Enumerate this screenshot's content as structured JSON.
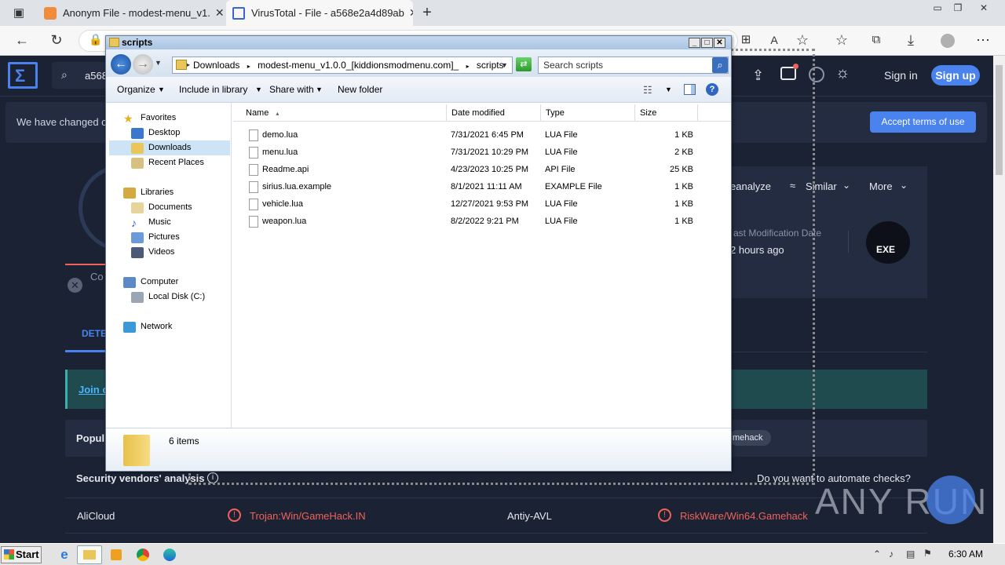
{
  "browser": {
    "tabs": [
      {
        "title": "Anonym File - modest-menu_v1.",
        "close": "✕"
      },
      {
        "title": "VirusTotal - File - a568e2a4d89ab",
        "close": "✕"
      }
    ],
    "new_tab": "+",
    "window_controls": [
      "▭",
      "❐",
      "✕"
    ]
  },
  "site": {
    "search_value": "a568",
    "sign_in": "Sign in",
    "sign_up": "Sign up",
    "banner_text": "We have changed o",
    "accept_button": "Accept terms of use",
    "actions": {
      "reanalyze": "eanalyze",
      "similar": "Similar",
      "more": "More"
    },
    "last_mod_label": "ast Modification Date",
    "last_mod_value": "2 hours ago",
    "file_type_badge": "EXE",
    "community_short": "Co",
    "tab_detection_short": "DETE",
    "join_link": "Join o",
    "popular_short": "Popul",
    "gamehack_tag": "mehack",
    "vendors_title": "Security vendors' analysis",
    "automate": "Do you want to automate checks?",
    "vendors": [
      {
        "name": "AliCloud",
        "result": "Trojan:Win/GameHack.IN"
      },
      {
        "name": "Antiy-AVL",
        "result": "RiskWare/Win64.Gamehack"
      }
    ],
    "accent": "#4a83ee",
    "alert_color": "#f0625b"
  },
  "explorer": {
    "title": "scripts",
    "breadcrumb": [
      "Downloads",
      "modest-menu_v1.0.0_[kiddionsmodmenu.com]_",
      "scripts"
    ],
    "search_placeholder": "Search scripts",
    "toolbar": {
      "organize": "Organize",
      "include": "Include in library",
      "share": "Share with",
      "new_folder": "New folder"
    },
    "nav": {
      "favorites": "Favorites",
      "desktop": "Desktop",
      "downloads": "Downloads",
      "recent": "Recent Places",
      "libraries": "Libraries",
      "documents": "Documents",
      "music": "Music",
      "pictures": "Pictures",
      "videos": "Videos",
      "computer": "Computer",
      "local_disk": "Local Disk (C:)",
      "network": "Network"
    },
    "columns": {
      "name": "Name",
      "date": "Date modified",
      "type": "Type",
      "size": "Size"
    },
    "files": [
      {
        "name": "demo.lua",
        "date": "7/31/2021 6:45 PM",
        "type": "LUA File",
        "size": "1 KB"
      },
      {
        "name": "menu.lua",
        "date": "7/31/2021 10:29 PM",
        "type": "LUA File",
        "size": "2 KB"
      },
      {
        "name": "Readme.api",
        "date": "4/23/2023 10:25 PM",
        "type": "API File",
        "size": "25 KB"
      },
      {
        "name": "sirius.lua.example",
        "date": "8/1/2021 11:11 AM",
        "type": "EXAMPLE File",
        "size": "1 KB"
      },
      {
        "name": "vehicle.lua",
        "date": "12/27/2021 9:53 PM",
        "type": "LUA File",
        "size": "1 KB"
      },
      {
        "name": "weapon.lua",
        "date": "8/2/2022 9:21 PM",
        "type": "LUA File",
        "size": "1 KB"
      }
    ],
    "status": "6 items"
  },
  "taskbar": {
    "start": "Start",
    "clock": "6:30 AM"
  },
  "watermark": "ANY RUN"
}
